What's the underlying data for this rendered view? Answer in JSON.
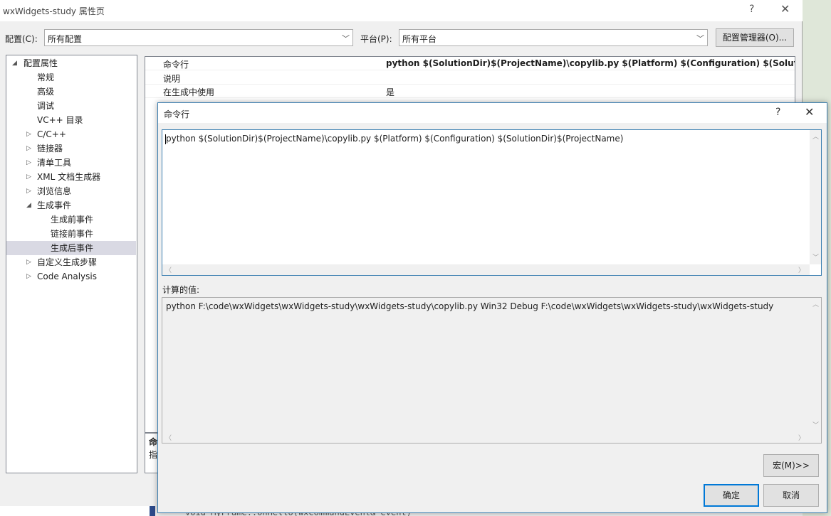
{
  "window": {
    "title": "wxWidgets-study 属性页",
    "help_glyph": "?",
    "close_glyph": "✕"
  },
  "config_row": {
    "config_label": "配置(C):",
    "config_value": "所有配置",
    "platform_label": "平台(P):",
    "platform_value": "所有平台",
    "manager_button": "配置管理器(O)..."
  },
  "tree": {
    "root": "配置属性",
    "items": [
      "常规",
      "高级",
      "调试",
      "VC++ 目录",
      "C/C++",
      "链接器",
      "清单工具",
      "XML 文档生成器",
      "浏览信息",
      "生成事件",
      "生成前事件",
      "链接前事件",
      "生成后事件",
      "自定义生成步骤",
      "Code Analysis"
    ],
    "selected": "生成后事件"
  },
  "grid": {
    "rows": [
      {
        "key": "命令行",
        "value": "python $(SolutionDir)$(ProjectName)\\copylib.py $(Platform) $(Configuration) $(SolutionDir)$(ProjectName)"
      },
      {
        "key": "说明",
        "value": ""
      },
      {
        "key": "在生成中使用",
        "value": "是"
      }
    ]
  },
  "description": {
    "line1": "命",
    "line2": "指"
  },
  "dialog": {
    "title": "命令行",
    "help_glyph": "?",
    "close_glyph": "✕",
    "command_text": "python $(SolutionDir)$(ProjectName)\\copylib.py $(Platform) $(Configuration) $(SolutionDir)$(ProjectName)",
    "evaluated_label": "计算的值:",
    "evaluated_text": "python F:\\code\\wxWidgets\\wxWidgets-study\\wxWidgets-study\\copylib.py Win32 Debug F:\\code\\wxWidgets\\wxWidgets-study\\wxWidgets-study",
    "macro_button": "宏(M)>>",
    "ok_button": "确定",
    "cancel_button": "取消"
  },
  "background_code": "void MyFrame::OnHello(wxCommandEvent& event)",
  "colors": {
    "accent": "#0078d7",
    "selection": "#d9d9e3",
    "dialog_border": "#3c7fb1"
  }
}
